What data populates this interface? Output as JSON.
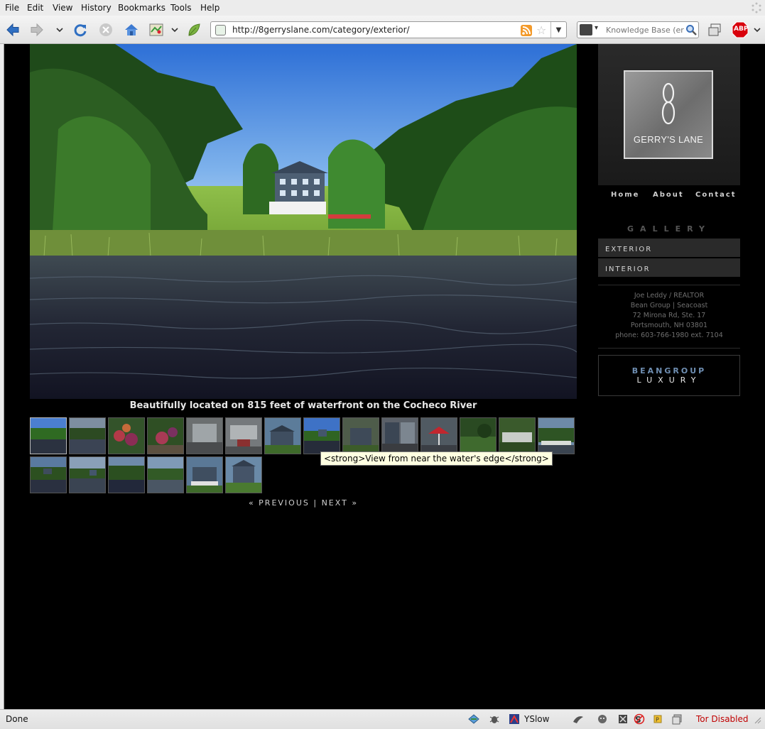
{
  "menubar": {
    "items": [
      "File",
      "Edit",
      "View",
      "History",
      "Bookmarks",
      "Tools",
      "Help"
    ]
  },
  "navbar": {
    "url": "http://8gerryslane.com/category/exterior/",
    "search_placeholder": "Knowledge Base (er",
    "abp_label": "ABP"
  },
  "page": {
    "caption": "Beautifully located on 815 feet of waterfront on the Cocheco River",
    "tooltip": "<strong>View from near the water's edge</strong>",
    "pager": {
      "previous": "« PREVIOUS",
      "separator": "|",
      "next": "NEXT »"
    },
    "thumbnail_count": 20
  },
  "sidebar": {
    "logo_name": "GERRY'S LANE",
    "nav": [
      "Home",
      "About",
      "Contact"
    ],
    "gallery_heading": "GALLERY",
    "categories": [
      "EXTERIOR",
      "INTERIOR"
    ],
    "contact": {
      "line1": "Joe Leddy / REALTOR",
      "line2": "Bean Group | Seacoast",
      "line3": "72 Mirona Rd, Ste. 17",
      "line4": "Portsmouth, NH 03801",
      "line5": "phone: 603-766-1980 ext. 7104"
    },
    "brand_line1": "BEANGROUP",
    "brand_line2": "LUXURY"
  },
  "statusbar": {
    "status": "Done",
    "yslow": "YSlow",
    "tor": "Tor Disabled"
  },
  "colors": {
    "page_bg": "#000000",
    "caption": "#e6e6e6",
    "brand_blue": "#6f8fb3",
    "tor_red": "#c00000"
  }
}
